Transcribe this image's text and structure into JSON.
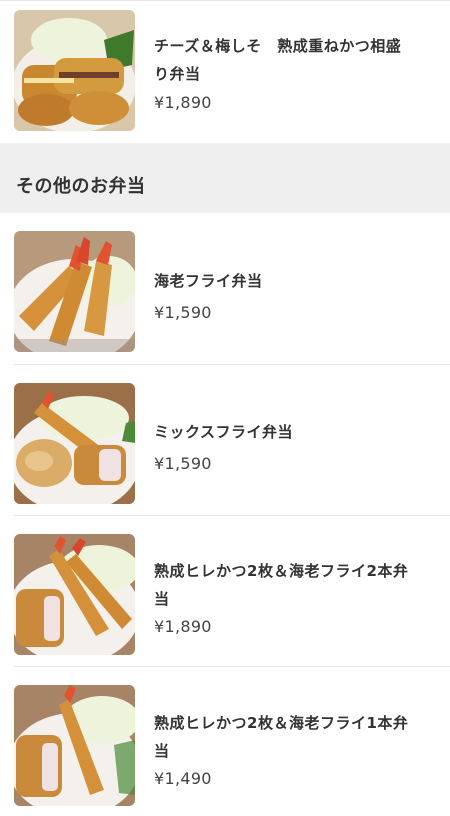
{
  "section": {
    "title": "その他のお弁当"
  },
  "items": [
    {
      "name": "チーズ＆梅しそ　熟成重ねかつ相盛り弁当",
      "price": "¥1,890",
      "image": "cutlet-bento-photo"
    },
    {
      "name": "海老フライ弁当",
      "price": "¥1,590",
      "image": "fried-shrimp-bento-photo"
    },
    {
      "name": "ミックスフライ弁当",
      "price": "¥1,590",
      "image": "mixed-fry-bento-photo"
    },
    {
      "name": "熟成ヒレかつ2枚＆海老フライ2本弁当",
      "price": "¥1,890",
      "image": "fillet-shrimp-bento-photo"
    },
    {
      "name": "熟成ヒレかつ2枚＆海老フライ1本弁当",
      "price": "¥1,490",
      "image": "fillet-shrimp-bento-photo"
    }
  ]
}
